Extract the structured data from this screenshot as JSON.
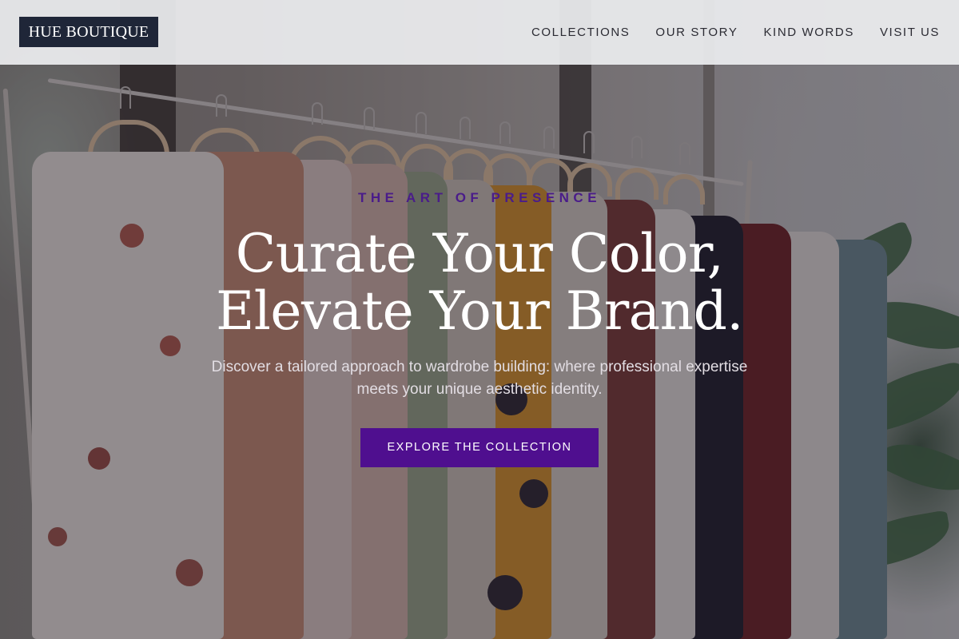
{
  "header": {
    "logo_text": "HUE BOUTIQUE",
    "nav": [
      {
        "label": "COLLECTIONS"
      },
      {
        "label": "OUR STORY"
      },
      {
        "label": "KIND WORDS"
      },
      {
        "label": "VISIT US"
      }
    ]
  },
  "hero": {
    "eyebrow": "THE ART OF PRESENCE",
    "headline_line1": "Curate Your Color,",
    "headline_line2": "Elevate Your Brand.",
    "subtitle": "Discover a tailored approach to wardrobe building: where professional expertise meets your unique aesthetic identity.",
    "cta_label": "EXPLORE THE COLLECTION",
    "background_image": "clothing-rack-photo"
  },
  "colors": {
    "logo_bg": "#1f2638",
    "accent": "#4f0f8f",
    "eyebrow": "#4a1c8a",
    "header_bg": "#ecedef"
  }
}
